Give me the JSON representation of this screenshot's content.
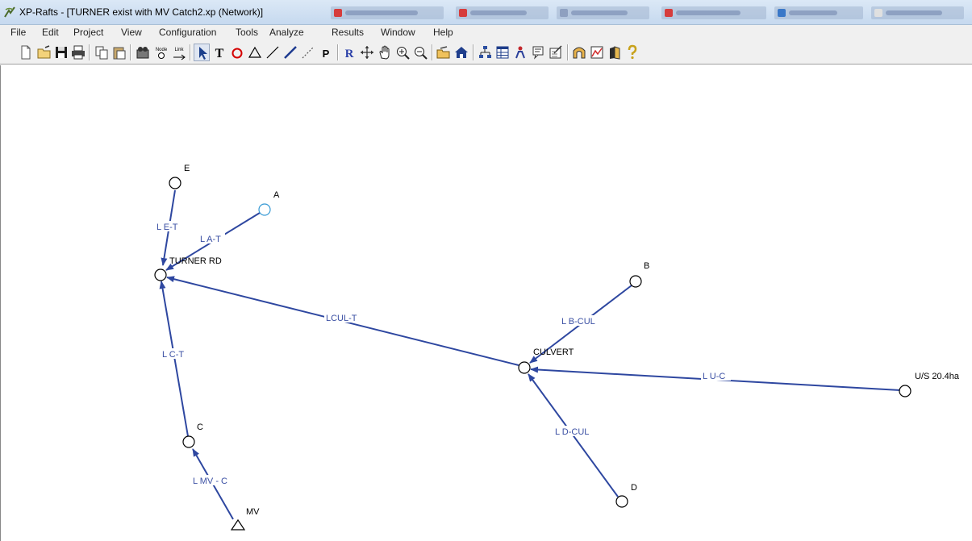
{
  "window": {
    "title": "XP-Rafts - [TURNER exist with MV Catch2.xp (Network)]"
  },
  "menu": {
    "items": [
      "File",
      "Edit",
      "Project",
      "View",
      "Configuration",
      "Tools",
      "Analyze",
      "Results",
      "Window",
      "Help"
    ]
  },
  "toolbar": {
    "node_label_top": "Node",
    "link_label_top": "Link",
    "text_tool_label": "T",
    "p_tool_label": "P",
    "r_tool_label": "R",
    "icons": [
      "new-file-icon",
      "open-folder-icon",
      "save-icon",
      "print-icon",
      "copy-icon",
      "paste-icon",
      "find-icon",
      "node-icon",
      "link-icon",
      "select-arrow-icon",
      "text-icon",
      "circle-icon",
      "triangle-icon",
      "thin-line-icon",
      "thick-line-icon",
      "dashed-line-icon",
      "p-icon",
      "r-icon",
      "move-icon",
      "pan-hand-icon",
      "zoom-in-icon",
      "zoom-out-icon",
      "open-file-icon",
      "home-icon",
      "tree-icon",
      "table-icon",
      "person-icon",
      "notes-icon",
      "properties-icon",
      "arch-icon",
      "graph-icon",
      "book-icon",
      "help-icon"
    ]
  },
  "network": {
    "nodes": [
      {
        "id": "E",
        "label": "E",
        "shape": "circle"
      },
      {
        "id": "A",
        "label": "A",
        "shape": "circle",
        "color": "#3a9bd5"
      },
      {
        "id": "TURNER",
        "label": "TURNER RD",
        "shape": "circle"
      },
      {
        "id": "B",
        "label": "B",
        "shape": "circle"
      },
      {
        "id": "CULVERT",
        "label": "CULVERT",
        "shape": "circle"
      },
      {
        "id": "US",
        "label": "U/S 20.4ha",
        "shape": "circle"
      },
      {
        "id": "C",
        "label": "C",
        "shape": "circle"
      },
      {
        "id": "D",
        "label": "D",
        "shape": "circle"
      },
      {
        "id": "MV",
        "label": "MV",
        "shape": "triangle"
      }
    ],
    "links": [
      {
        "id": "LET",
        "label": "L E-T",
        "from": "E",
        "to": "TURNER"
      },
      {
        "id": "LAT",
        "label": "L A-T",
        "from": "A",
        "to": "TURNER"
      },
      {
        "id": "LCULT",
        "label": "LCUL-T",
        "from": "CULVERT",
        "to": "TURNER"
      },
      {
        "id": "LCT",
        "label": "L C-T",
        "from": "C",
        "to": "TURNER"
      },
      {
        "id": "LMVC",
        "label": "L MV - C",
        "from": "MV",
        "to": "C"
      },
      {
        "id": "LBCUL",
        "label": "L B-CUL",
        "from": "B",
        "to": "CULVERT"
      },
      {
        "id": "LUC",
        "label": "L U-C",
        "from": "US",
        "to": "CULVERT"
      },
      {
        "id": "LDCUL",
        "label": "L D-CUL",
        "from": "D",
        "to": "CULVERT"
      }
    ],
    "link_color": "#2e47a0"
  }
}
